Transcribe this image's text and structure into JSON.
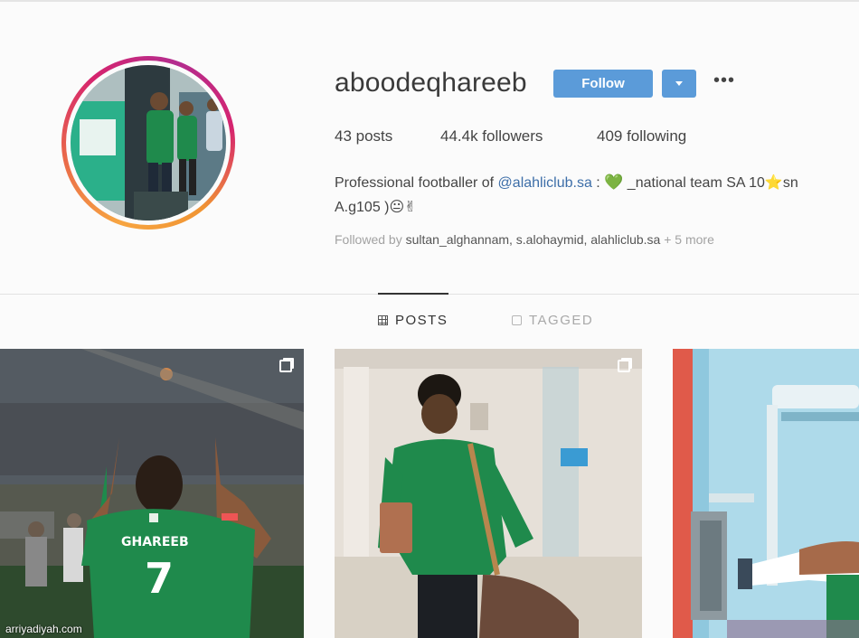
{
  "profile": {
    "username": "aboodeqhareeb",
    "follow_label": "Follow",
    "more_label": "•••",
    "stats": {
      "posts": "43 posts",
      "followers": "44.4k followers",
      "following": "409 following"
    },
    "bio": {
      "prefix": "Professional footballer of ",
      "club_link": "@alahliclub.sa",
      "mid": " : ",
      "heart": "💚",
      "after_heart": " _national team SA 10",
      "star": "⭐",
      "tail": "sn",
      "line2": "A.g105 )😐✌"
    },
    "followed_by": {
      "prefix": "Followed by ",
      "names": "sultan_alghannam, s.alohaymid, alahliclub.sa",
      "more": " + 5 more"
    }
  },
  "tabs": {
    "posts": "POSTS",
    "tagged": "TAGGED"
  },
  "posts": [
    {
      "jersey_name": "GHAREEB",
      "jersey_number": "7"
    }
  ],
  "watermark": "arriyadiyah.com",
  "colors": {
    "follow_button": "#5b9bd9",
    "link": "#3d6ea8",
    "kit_green": "#1f8a4c"
  }
}
